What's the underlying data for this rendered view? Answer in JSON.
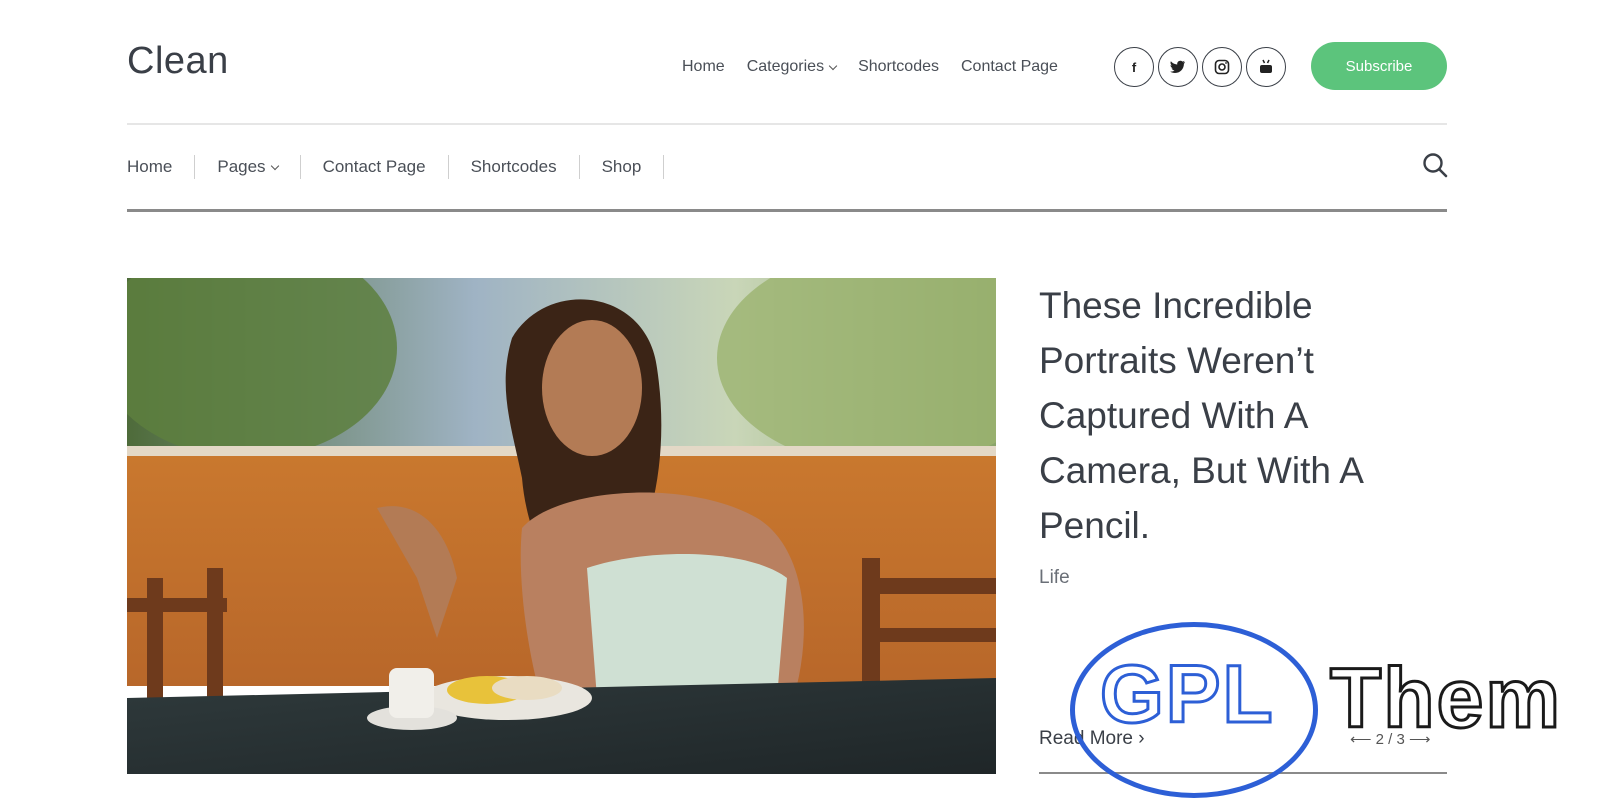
{
  "header": {
    "logo": "Clean",
    "top_nav": [
      "Home",
      "Categories",
      "Shortcodes",
      "Contact Page"
    ],
    "socials": [
      "facebook-icon",
      "twitter-icon",
      "instagram-icon",
      "youtube-icon"
    ],
    "subscribe_label": "Subscribe"
  },
  "main_nav": [
    "Home",
    "Pages",
    "Contact Page",
    "Shortcodes",
    "Shop"
  ],
  "post": {
    "title": "These Incredible Portraits Weren’t Captured With A Camera, But With A Pencil.",
    "category": "Life",
    "read_more": "Read More ›",
    "pager": "2 / 3"
  },
  "watermark": {
    "left": "GPL",
    "right": "Them"
  },
  "colors": {
    "accent": "#5cc47c",
    "watermark_blue": "#2d5fd6"
  }
}
